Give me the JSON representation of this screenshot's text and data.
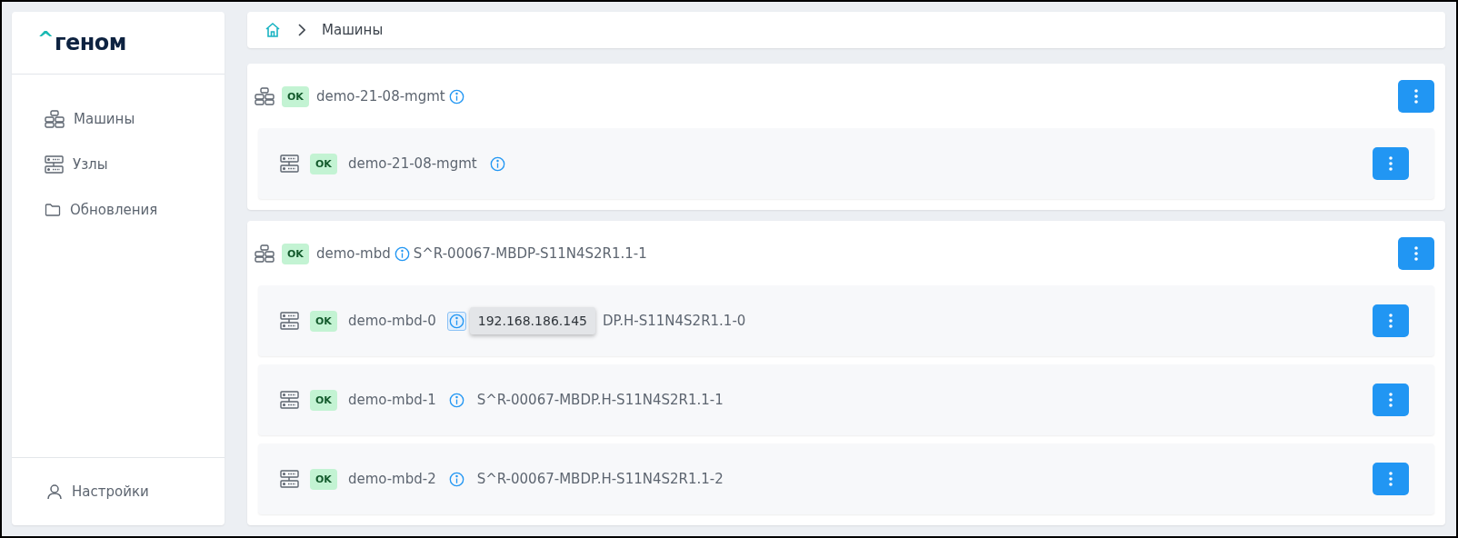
{
  "logo": {
    "mark": "^",
    "text": "геном"
  },
  "sidebar": {
    "items": [
      {
        "label": "Машины"
      },
      {
        "label": "Узлы"
      },
      {
        "label": "Обновления"
      }
    ],
    "footer": {
      "label": "Настройки"
    }
  },
  "breadcrumb": {
    "current": "Машины"
  },
  "machines": [
    {
      "status": "OK",
      "name": "demo-21-08-mgmt",
      "nodes": [
        {
          "status": "OK",
          "name": "demo-21-08-mgmt",
          "info_active": false
        }
      ]
    },
    {
      "status": "OK",
      "name": "demo-mbd",
      "serial": "S^R-00067-MBDP-S11N4S2R1.1-1",
      "nodes": [
        {
          "status": "OK",
          "name": "demo-mbd-0",
          "info_active": true,
          "tooltip": "192.168.186.145",
          "serial": "DP.H-S11N4S2R1.1-0"
        },
        {
          "status": "OK",
          "name": "demo-mbd-1",
          "info_active": false,
          "serial": "S^R-00067-MBDP.H-S11N4S2R1.1-1"
        },
        {
          "status": "OK",
          "name": "demo-mbd-2",
          "info_active": false,
          "serial": "S^R-00067-MBDP.H-S11N4S2R1.1-2"
        }
      ]
    }
  ]
}
